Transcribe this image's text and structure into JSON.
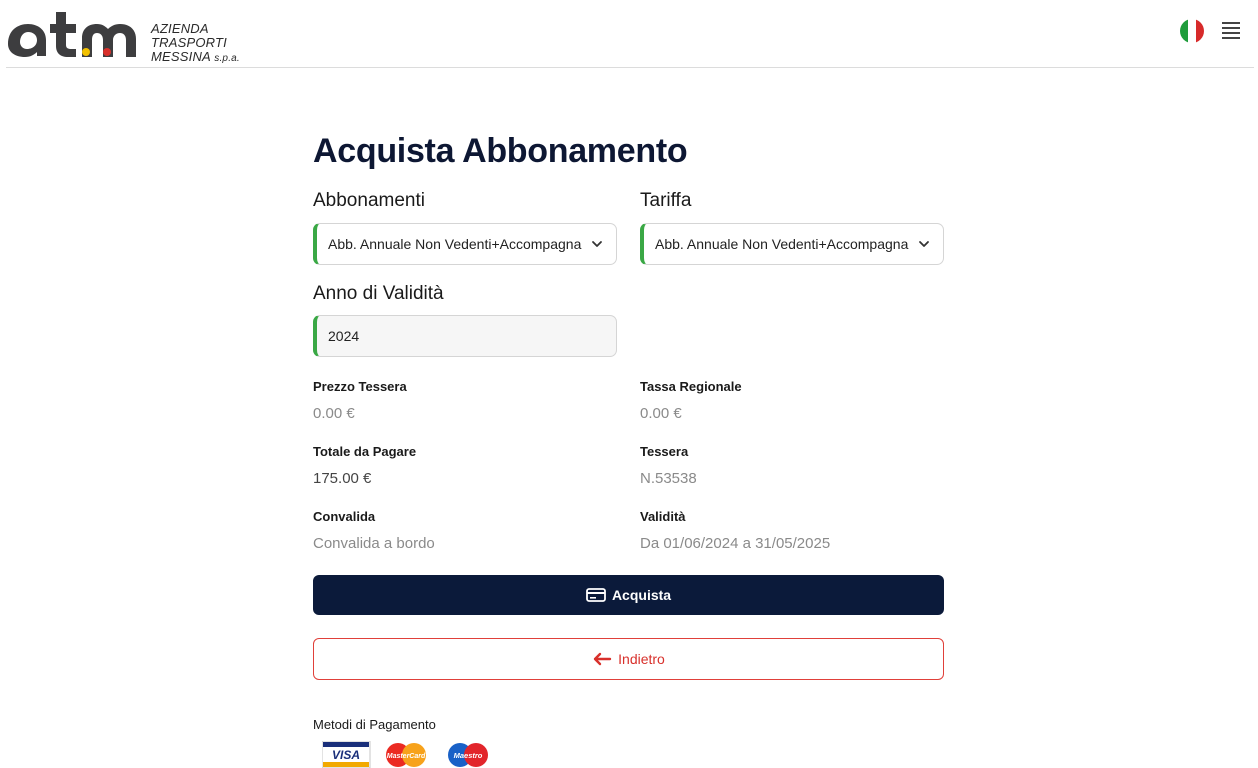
{
  "header": {
    "logo_text": "atm",
    "logo_lines": [
      "AZIENDA",
      "TRASPORTI",
      "MESSINA"
    ],
    "logo_suffix": "s.p.a.",
    "flag_colors": [
      "#1f9c3b",
      "#ffffff",
      "#d72a2a"
    ],
    "menu_icon": "hamburger-menu-icon"
  },
  "main": {
    "title": "Acquista Abbonamento",
    "abbonamenti": {
      "label": "Abbonamenti",
      "value": "Abb. Annuale Non Vedenti+Accompagna"
    },
    "tariffa": {
      "label": "Tariffa",
      "value": "Abb. Annuale Non Vedenti+Accompagna"
    },
    "anno": {
      "label": "Anno di Validità",
      "value": "2024"
    },
    "info": {
      "prezzo_tessera": {
        "label": "Prezzo Tessera",
        "value": "0.00 €"
      },
      "tassa_regionale": {
        "label": "Tassa Regionale",
        "value": "0.00 €"
      },
      "totale": {
        "label": "Totale da Pagare",
        "value": "175.00 €"
      },
      "tessera": {
        "label": "Tessera",
        "value": "N.53538"
      },
      "convalida": {
        "label": "Convalida",
        "value": "Convalida a bordo"
      },
      "validita": {
        "label": "Validità",
        "value": "Da 01/06/2024 a 31/05/2025"
      }
    },
    "acquista_label": "Acquista",
    "indietro_label": "Indietro",
    "payment_methods_label": "Metodi di Pagamento",
    "payment_cards": [
      "VISA",
      "MasterCard",
      "Maestro"
    ],
    "colors": {
      "primary_navy": "#0b1a3a",
      "accent_green": "#3aa845",
      "danger_red": "#e0403a"
    }
  }
}
